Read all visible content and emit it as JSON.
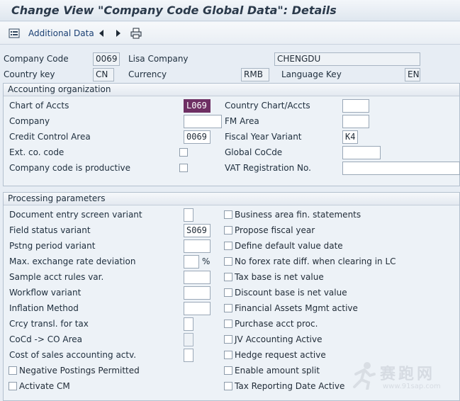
{
  "title": "Change View \"Company Code Global Data\": Details",
  "toolbar": {
    "additional_data": "Additional Data"
  },
  "header": {
    "company_code_label": "Company Code",
    "company_code_value": "0069",
    "company_name": "Lisa Company",
    "city": "CHENGDU",
    "country_key_label": "Country key",
    "country_key_value": "CN",
    "currency_label": "Currency",
    "currency_value": "RMB",
    "language_key_label": "Language Key",
    "language_key_value": "EN"
  },
  "accounting_org": {
    "title": "Accounting organization",
    "chart_of_accts_label": "Chart of Accts",
    "chart_of_accts_value": "L069",
    "company_label": "Company",
    "credit_control_label": "Credit Control Area",
    "credit_control_value": "0069",
    "ext_co_code_label": "Ext. co. code",
    "productive_label": "Company code is productive",
    "country_chart_label": "Country Chart/Accts",
    "fm_area_label": "FM Area",
    "fiscal_year_variant_label": "Fiscal Year Variant",
    "fiscal_year_variant_value": "K4",
    "global_cocde_label": "Global CoCde",
    "vat_reg_label": "VAT Registration No."
  },
  "processing": {
    "title": "Processing parameters",
    "left": {
      "doc_entry": "Document entry screen variant",
      "field_status": "Field status variant",
      "field_status_value": "S069",
      "pstng_period": "Pstng period variant",
      "max_exchange": "Max. exchange rate deviation",
      "percent": "%",
      "sample_acct": "Sample acct rules var.",
      "workflow": "Workflow variant",
      "inflation": "Inflation Method",
      "crcy_transl": "Crcy transl. for tax",
      "cocd_co": "CoCd -> CO Area",
      "cost_of_sales": "Cost of sales accounting actv.",
      "negative_postings": "Negative Postings Permitted",
      "activate_cm": "Activate CM"
    },
    "right": [
      "Business area fin. statements",
      "Propose fiscal year",
      "Define default value date",
      "No forex rate diff. when clearing in LC",
      "Tax base is net value",
      "Discount base is net value",
      "Financial Assets Mgmt active",
      "Purchase acct proc.",
      "JV Accounting Active",
      "Hedge request active",
      "Enable amount split",
      "Tax Reporting Date Active"
    ]
  },
  "watermark": {
    "text": "赛跑网",
    "url": "www.91sap.com"
  }
}
